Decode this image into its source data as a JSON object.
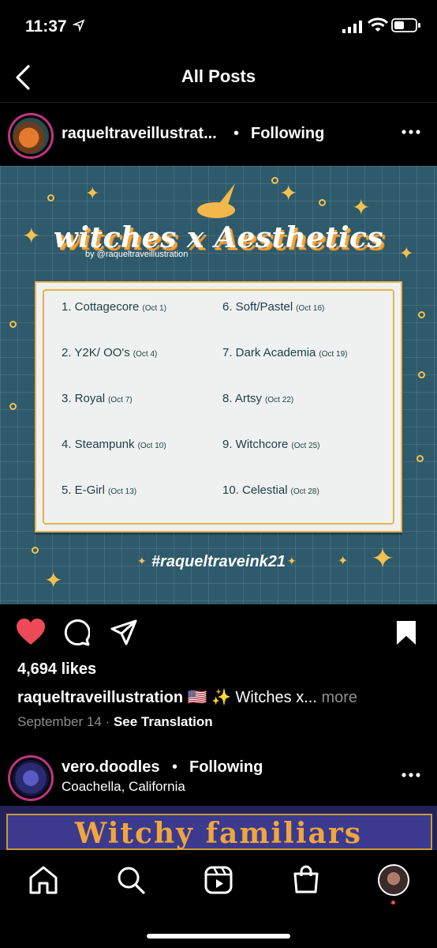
{
  "status": {
    "time": "11:37"
  },
  "header": {
    "title": "All Posts"
  },
  "post1": {
    "username": "raqueltraveillustrat...",
    "separator": "•",
    "follow_label": "Following",
    "image": {
      "title": "witches x Aesthetics",
      "byline": "by @raqueltraveillustration",
      "prompts_left": [
        {
          "label": "1. Cottagecore",
          "date": "(Oct 1)"
        },
        {
          "label": "2. Y2K/ OO's",
          "date": "(Oct 4)"
        },
        {
          "label": "3. Royal",
          "date": "(Oct 7)"
        },
        {
          "label": "4. Steampunk",
          "date": "(Oct 10)"
        },
        {
          "label": "5. E-Girl",
          "date": "(Oct 13)"
        }
      ],
      "prompts_right": [
        {
          "label": "6. Soft/Pastel",
          "date": "(Oct 16)"
        },
        {
          "label": "7. Dark Academia",
          "date": "(Oct 19)"
        },
        {
          "label": "8. Artsy",
          "date": "(Oct 22)"
        },
        {
          "label": "9. Witchcore",
          "date": "(Oct 25)"
        },
        {
          "label": "10. Celestial",
          "date": "(Oct 28)"
        }
      ],
      "hashtag": "#raqueltraveink21"
    },
    "likes": "4,694 likes",
    "caption_user": "raqueltraveillustration",
    "caption_text": "🇺🇸 ✨ Witches x...",
    "caption_more": "more",
    "date": "September 14",
    "meta_separator": "·",
    "translate_label": "See Translation"
  },
  "post2": {
    "username": "vero.doodles",
    "separator": "•",
    "follow_label": "Following",
    "location": "Coachella, California",
    "image_title": "Witchy familiars"
  },
  "colors": {
    "like": "#ed4956",
    "story_ring": "#c13584",
    "poster_bg": "#2e5a6b",
    "poster_accent": "#e9b24c"
  }
}
